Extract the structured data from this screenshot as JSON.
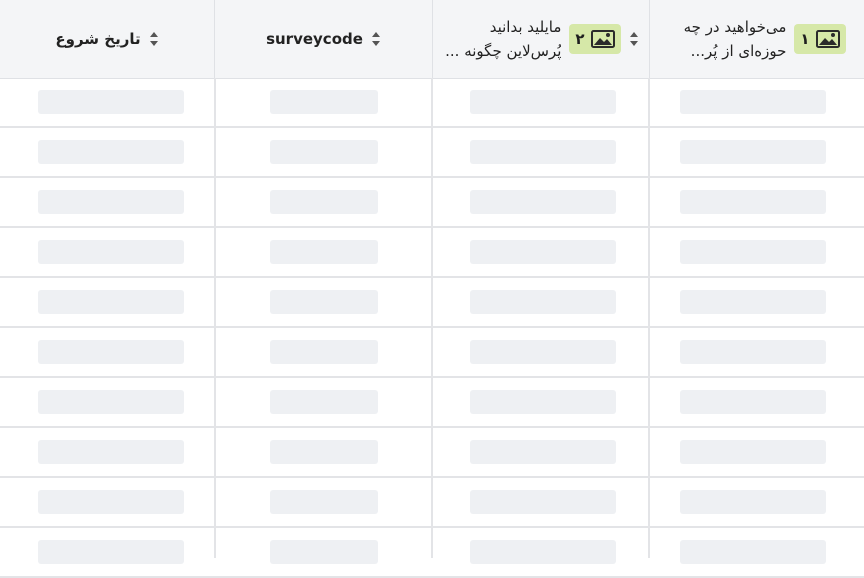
{
  "columns": [
    {
      "id": "q1",
      "number": "۱",
      "line1": "می‌خواهید در چه",
      "line2": "حوزه‌ای از پُر..."
    },
    {
      "id": "q2",
      "number": "۲",
      "line1": "مایلید بدانید",
      "line2": "پُرس‌لاین چگونه ..."
    },
    {
      "id": "surveycode",
      "title": "surveycode"
    },
    {
      "id": "start",
      "title": "تاریخ شروع"
    }
  ],
  "colors": {
    "badge": "#d6e8a8",
    "header_bg": "#f4f5f7",
    "placeholder": "#eef0f3"
  },
  "icons": {
    "image": "image-icon",
    "sort": "sort-icon"
  },
  "row_count": 10
}
